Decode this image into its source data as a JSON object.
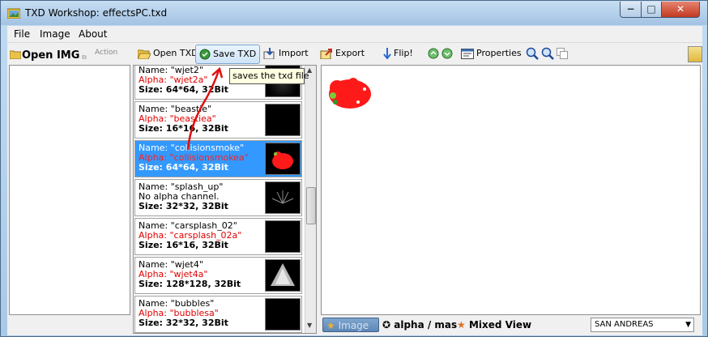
{
  "window": {
    "title": "TXD Workshop: effectsPC.txd"
  },
  "window_controls": {
    "minimize": "−",
    "maximize": "□",
    "close": "✕"
  },
  "menu": {
    "file": "File",
    "image": "Image",
    "about": "About"
  },
  "left": {
    "open_img_label": "Open IMG",
    "action_label": "Action"
  },
  "toolbar": {
    "open_txd": "Open TXD",
    "save_txd": "Save TXD",
    "import": "Import",
    "export": "Export",
    "flip": "Flip!",
    "properties": "Properties"
  },
  "tooltip": {
    "text": "saves the txd file"
  },
  "textures": [
    {
      "name": "Name: \"wjet2\"",
      "alpha": "Alpha: \"wjet2a\"",
      "size": "Size: 64*64, 32Bit",
      "has_alpha": true,
      "selected": false
    },
    {
      "name": "Name: \"beastie\"",
      "alpha": "Alpha: \"beastiea\"",
      "size": "Size: 16*16, 32Bit",
      "has_alpha": true,
      "selected": false
    },
    {
      "name": "Name: \"collisionsmoke\"",
      "alpha": "Alpha: \"collisionsmokea\"",
      "size": "Size: 64*64, 32Bit",
      "has_alpha": true,
      "selected": true
    },
    {
      "name": "Name: \"splash_up\"",
      "alpha": "No alpha channel.",
      "size": "Size: 32*32, 32Bit",
      "has_alpha": false,
      "selected": false
    },
    {
      "name": "Name: \"carsplash_02\"",
      "alpha": "Alpha: \"carsplash_02a\"",
      "size": "Size: 16*16, 32Bit",
      "has_alpha": true,
      "selected": false
    },
    {
      "name": "Name: \"wjet4\"",
      "alpha": "Alpha: \"wjet4a\"",
      "size": "Size: 128*128, 32Bit",
      "has_alpha": true,
      "selected": false
    },
    {
      "name": "Name: \"bubbles\"",
      "alpha": "Alpha: \"bubblesa\"",
      "size": "Size: 32*32, 32Bit",
      "has_alpha": true,
      "selected": false
    }
  ],
  "view_tabs": {
    "image": "Image",
    "alpha": "alpha / mas",
    "mixed": "Mixed View"
  },
  "game_select": {
    "value": "SAN ANDREAS"
  },
  "colors": {
    "selection": "#3399ff",
    "alpha_text": "#e00000",
    "smoke_red": "#ff1a1a"
  }
}
